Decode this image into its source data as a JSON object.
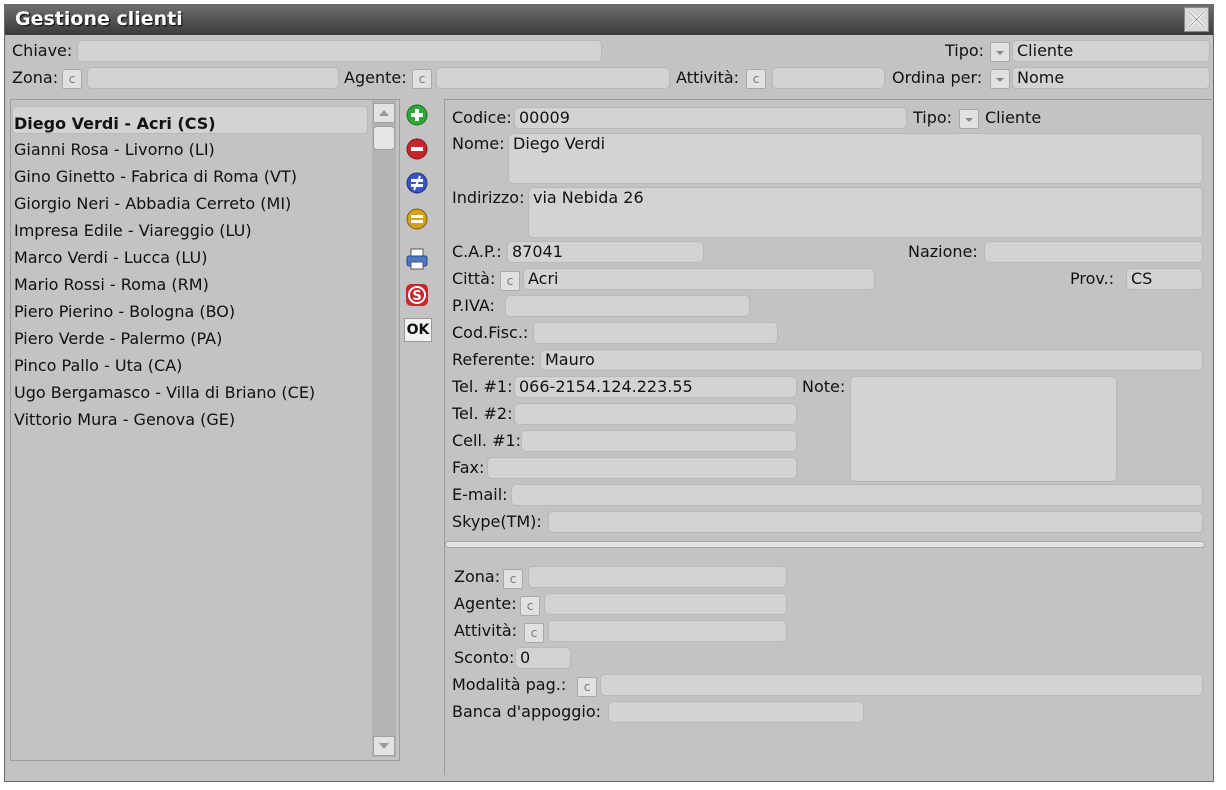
{
  "window": {
    "title": "Gestione clienti"
  },
  "filters": {
    "chiave_label": "Chiave:",
    "tipo_label": "Tipo:",
    "tipo_value": "Cliente",
    "zona_label": "Zona:",
    "agente_label": "Agente:",
    "attivita_label": "Attività:",
    "ordina_label": "Ordina per:",
    "ordina_value": "Nome",
    "c": "c"
  },
  "list": {
    "items": [
      "Diego Verdi - Acri (CS)",
      "Gianni Rosa - Livorno (LI)",
      "Gino Ginetto - Fabrica di Roma (VT)",
      "Giorgio Neri - Abbadia Cerreto (MI)",
      "Impresa Edile - Viareggio (LU)",
      "Marco Verdi - Lucca (LU)",
      "Mario Rossi - Roma (RM)",
      "Piero Pierino - Bologna (BO)",
      "Piero Verde - Palermo (PA)",
      "Pinco Pallo - Uta (CA)",
      "Ugo Bergamasco - Villa di Briano (CE)",
      "Vittorio Mura - Genova (GE)"
    ]
  },
  "toolbar": {
    "ok_label": "OK",
    "colors": {
      "add": "#2fa83a",
      "delete": "#c9252c",
      "edit": "#3a55c8",
      "equal": "#d2a21a",
      "skype": "#c8262c"
    }
  },
  "form": {
    "codice_label": "Codice:",
    "codice": "00009",
    "tipo_label": "Tipo:",
    "tipo": "Cliente",
    "nome_label": "Nome:",
    "nome": "Diego Verdi",
    "indirizzo_label": "Indirizzo:",
    "indirizzo": "via Nebida 26",
    "cap_label": "C.A.P.:",
    "cap": "87041",
    "nazione_label": "Nazione:",
    "nazione": "",
    "citta_label": "Città:",
    "citta": "Acri",
    "prov_label": "Prov.:",
    "prov": "CS",
    "piva_label": "P.IVA:",
    "codfisc_label": "Cod.Fisc.:",
    "referente_label": "Referente:",
    "referente": "Mauro",
    "tel1_label": "Tel. #1:",
    "tel1": "066-2154.124.223.55",
    "note_label": "Note:",
    "tel2_label": "Tel. #2:",
    "cell1_label": "Cell. #1:",
    "fax_label": "Fax:",
    "email_label": "E-mail:",
    "skype_label": "Skype(TM):",
    "zona_label": "Zona:",
    "agente_label": "Agente:",
    "attivita_label": "Attività:",
    "sconto_label": "Sconto:",
    "sconto": "0",
    "modalita_label": "Modalità pag.:",
    "banca_label": "Banca d'appoggio:"
  }
}
